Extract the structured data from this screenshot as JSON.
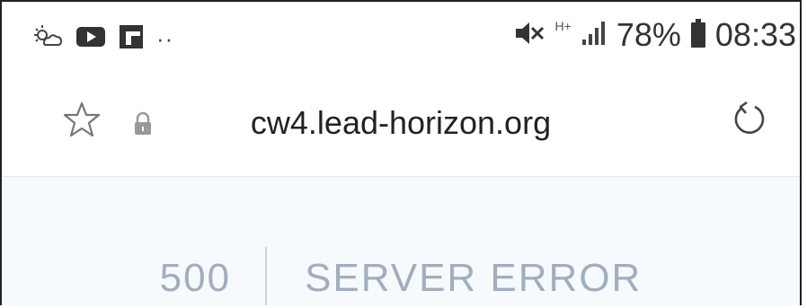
{
  "status_bar": {
    "battery_percent": "78%",
    "time": "08:33",
    "network_type": "H+",
    "overflow_dots": "··"
  },
  "address_bar": {
    "url": "cw4.lead-horizon.org"
  },
  "error": {
    "code": "500",
    "message": "SERVER ERROR"
  },
  "icons": {
    "status_left": [
      "weather-icon",
      "youtube-icon",
      "flipboard-icon"
    ],
    "status_right": [
      "mute-icon",
      "signal-icon",
      "battery-icon"
    ],
    "address": [
      "star-icon",
      "lock-icon",
      "reload-icon"
    ]
  },
  "colors": {
    "content_background": "#f7fafc",
    "error_text": "#a0aec0",
    "divider": "#cbd5e0"
  }
}
